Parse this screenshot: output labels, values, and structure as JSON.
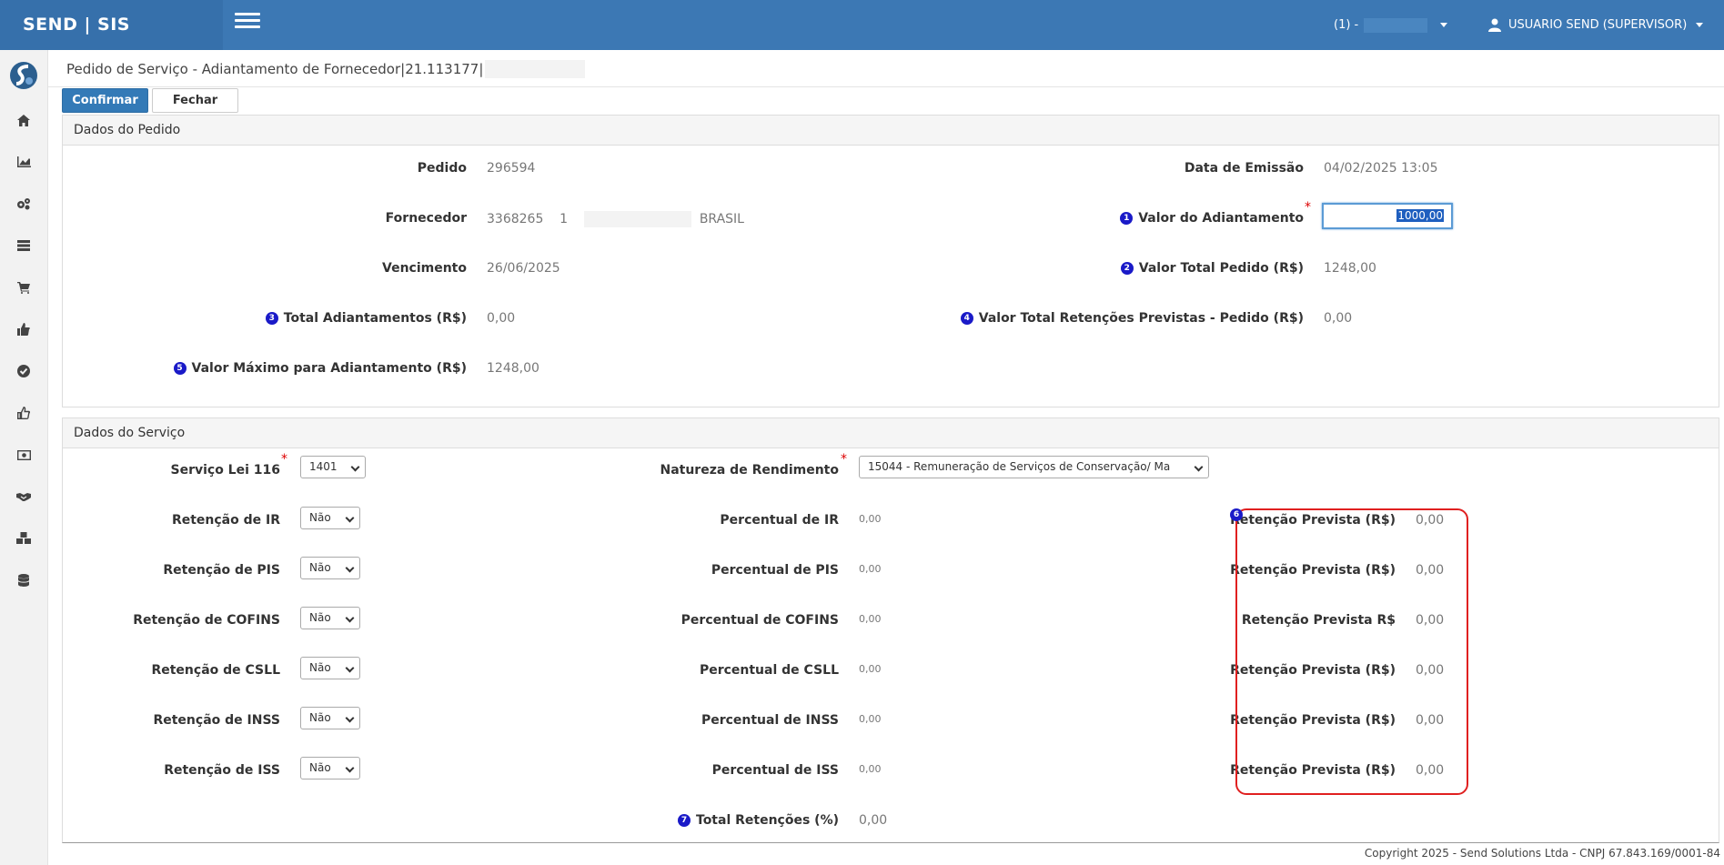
{
  "app": {
    "brand": "SEND | SIS",
    "company": "(1) -",
    "user": "USUARIO SEND (SUPERVISOR)"
  },
  "sidebar": {
    "items": [
      "home-icon",
      "chart-icon",
      "cogs-icon",
      "list-icon",
      "cart-icon",
      "thumbs-up-icon",
      "check-circle-icon",
      "thumbs-up-outline-icon",
      "money-icon",
      "handshake-icon",
      "cubes-icon",
      "database-icon"
    ]
  },
  "page": {
    "title": "Pedido de Serviço - Adiantamento de Fornecedor|21.113177|"
  },
  "toolbar": {
    "confirm": "Confirmar",
    "close": "Fechar"
  },
  "pedido": {
    "heading": "Dados do Pedido",
    "pedido_label": "Pedido",
    "pedido_value": "296594",
    "emissao_label": "Data de Emissão",
    "emissao_value": "04/02/2025 13:05",
    "fornecedor_label": "Fornecedor",
    "fornecedor_code": "3368265",
    "fornecedor_seq": "1",
    "fornecedor_country": "BRASIL",
    "adiantamento_label": "Valor do Adiantamento",
    "adiantamento_value": "1000,00",
    "vencimento_label": "Vencimento",
    "vencimento_value": "26/06/2025",
    "total_pedido_label": "Valor Total Pedido (R$)",
    "total_pedido_value": "1248,00",
    "total_adiant_label": "Total Adiantamentos (R$)",
    "total_adiant_value": "0,00",
    "retencoes_label": "Valor Total Retenções Previstas - Pedido (R$)",
    "retencoes_value": "0,00",
    "max_adiant_label": "Valor Máximo para Adiantamento (R$)",
    "max_adiant_value": "1248,00"
  },
  "servico": {
    "heading": "Dados do Serviço",
    "lei_label": "Serviço Lei 116",
    "lei_value": "1401",
    "natureza_label": "Natureza de Rendimento",
    "natureza_value": "15044 - Remuneração de Serviços de Conservação/ Ma",
    "rows": [
      {
        "ret_label": "Retenção de IR",
        "ret_value": "Não",
        "perc_label": "Percentual de IR",
        "perc_value": "0,00",
        "prev_label": "Retenção Prevista (R$)",
        "prev_value": "0,00"
      },
      {
        "ret_label": "Retenção de PIS",
        "ret_value": "Não",
        "perc_label": "Percentual de PIS",
        "perc_value": "0,00",
        "prev_label": "Retenção Prevista (R$)",
        "prev_value": "0,00"
      },
      {
        "ret_label": "Retenção de COFINS",
        "ret_value": "Não",
        "perc_label": "Percentual de COFINS",
        "perc_value": "0,00",
        "prev_label": "Retenção Prevista R$",
        "prev_value": "0,00"
      },
      {
        "ret_label": "Retenção de CSLL",
        "ret_value": "Não",
        "perc_label": "Percentual de CSLL",
        "perc_value": "0,00",
        "prev_label": "Retenção Prevista (R$)",
        "prev_value": "0,00"
      },
      {
        "ret_label": "Retenção de INSS",
        "ret_value": "Não",
        "perc_label": "Percentual de INSS",
        "perc_value": "0,00",
        "prev_label": "Retenção Prevista (R$)",
        "prev_value": "0,00"
      },
      {
        "ret_label": "Retenção de ISS",
        "ret_value": "Não",
        "perc_label": "Percentual de ISS",
        "perc_value": "0,00",
        "prev_label": "Retenção Prevista (R$)",
        "prev_value": "0,00"
      }
    ],
    "total_label": "Total Retenções (%)",
    "total_value": "0,00"
  },
  "markers": [
    "1",
    "2",
    "3",
    "4",
    "5",
    "6",
    "7"
  ],
  "footer": {
    "copyright": "Copyright 2025 - Send Solutions Ltda - CNPJ 67.843.169/0001-84"
  },
  "colors": {
    "topbar": "#3c78b4",
    "primary": "#337ab7",
    "marker": "#1a1ac8",
    "highlight_box": "#e02020"
  }
}
